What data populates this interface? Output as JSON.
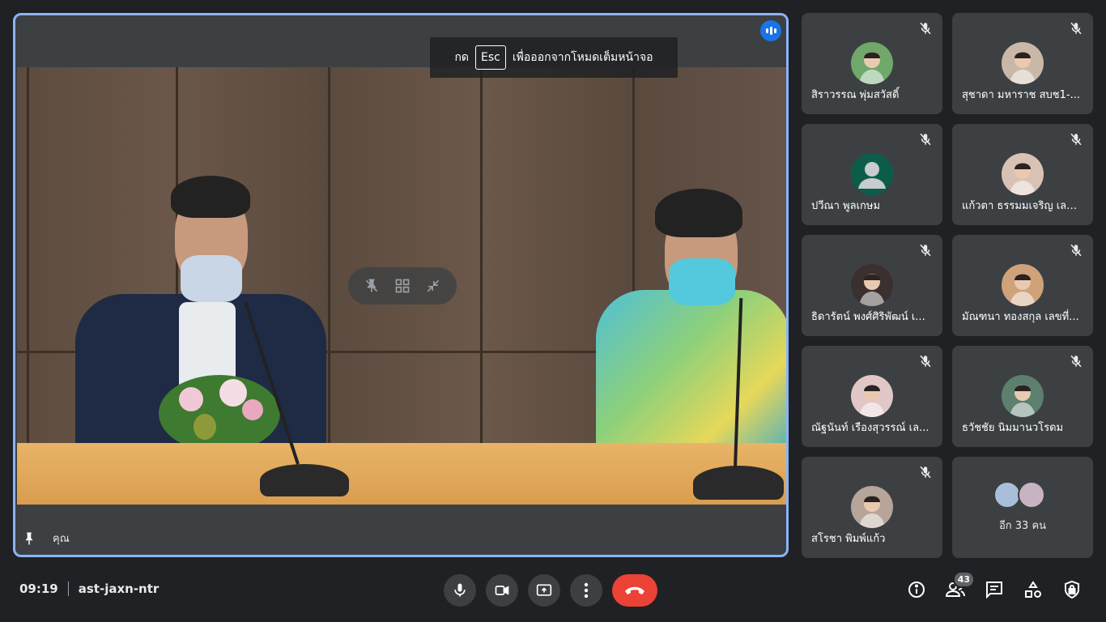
{
  "main": {
    "esc_before": "กด",
    "esc_key": "Esc",
    "esc_after": "เพื่อออกจากโหมดเต็มหน้าจอ",
    "you_label": "คุณ"
  },
  "participants": [
    {
      "name": "สิราวรรณ พุ่มสวัสดิ์",
      "avatar_color": "#6fa86a"
    },
    {
      "name": "สุชาดา มหาราช สบช1-...",
      "avatar_color": "#c9b8a8"
    },
    {
      "name": "ปวีณา พูลเกษม",
      "avatar_color": "#0b5d4a"
    },
    {
      "name": "แก้วตา ธรรมมเจริญ เลข...",
      "avatar_color": "#d9c2b4"
    },
    {
      "name": "ธิดารัตน์ พงศ์ศิริพัฒน์ เ...",
      "avatar_color": "#3b3030"
    },
    {
      "name": "มัณฑนา ทองสกุล เลขที่...",
      "avatar_color": "#cfa27a"
    },
    {
      "name": "ณัฐนันท์ เรืองสุวรรณ์ เล...",
      "avatar_color": "#e2c7c9"
    },
    {
      "name": "ธวัชชัย นิมมานวโรดม",
      "avatar_color": "#5c7f6e"
    },
    {
      "name": "สโรชา พิมพ์แก้ว",
      "avatar_color": "#b7a59a"
    }
  ],
  "more": {
    "label": "อีก 33 คน"
  },
  "bottom": {
    "time": "09:19",
    "meeting_code": "ast-jaxn-ntr",
    "people_count": "43"
  },
  "colors": {
    "accent": "#8ab4f8",
    "end_call": "#ea4335",
    "tile_bg": "#3c4043",
    "bg": "#202124"
  }
}
